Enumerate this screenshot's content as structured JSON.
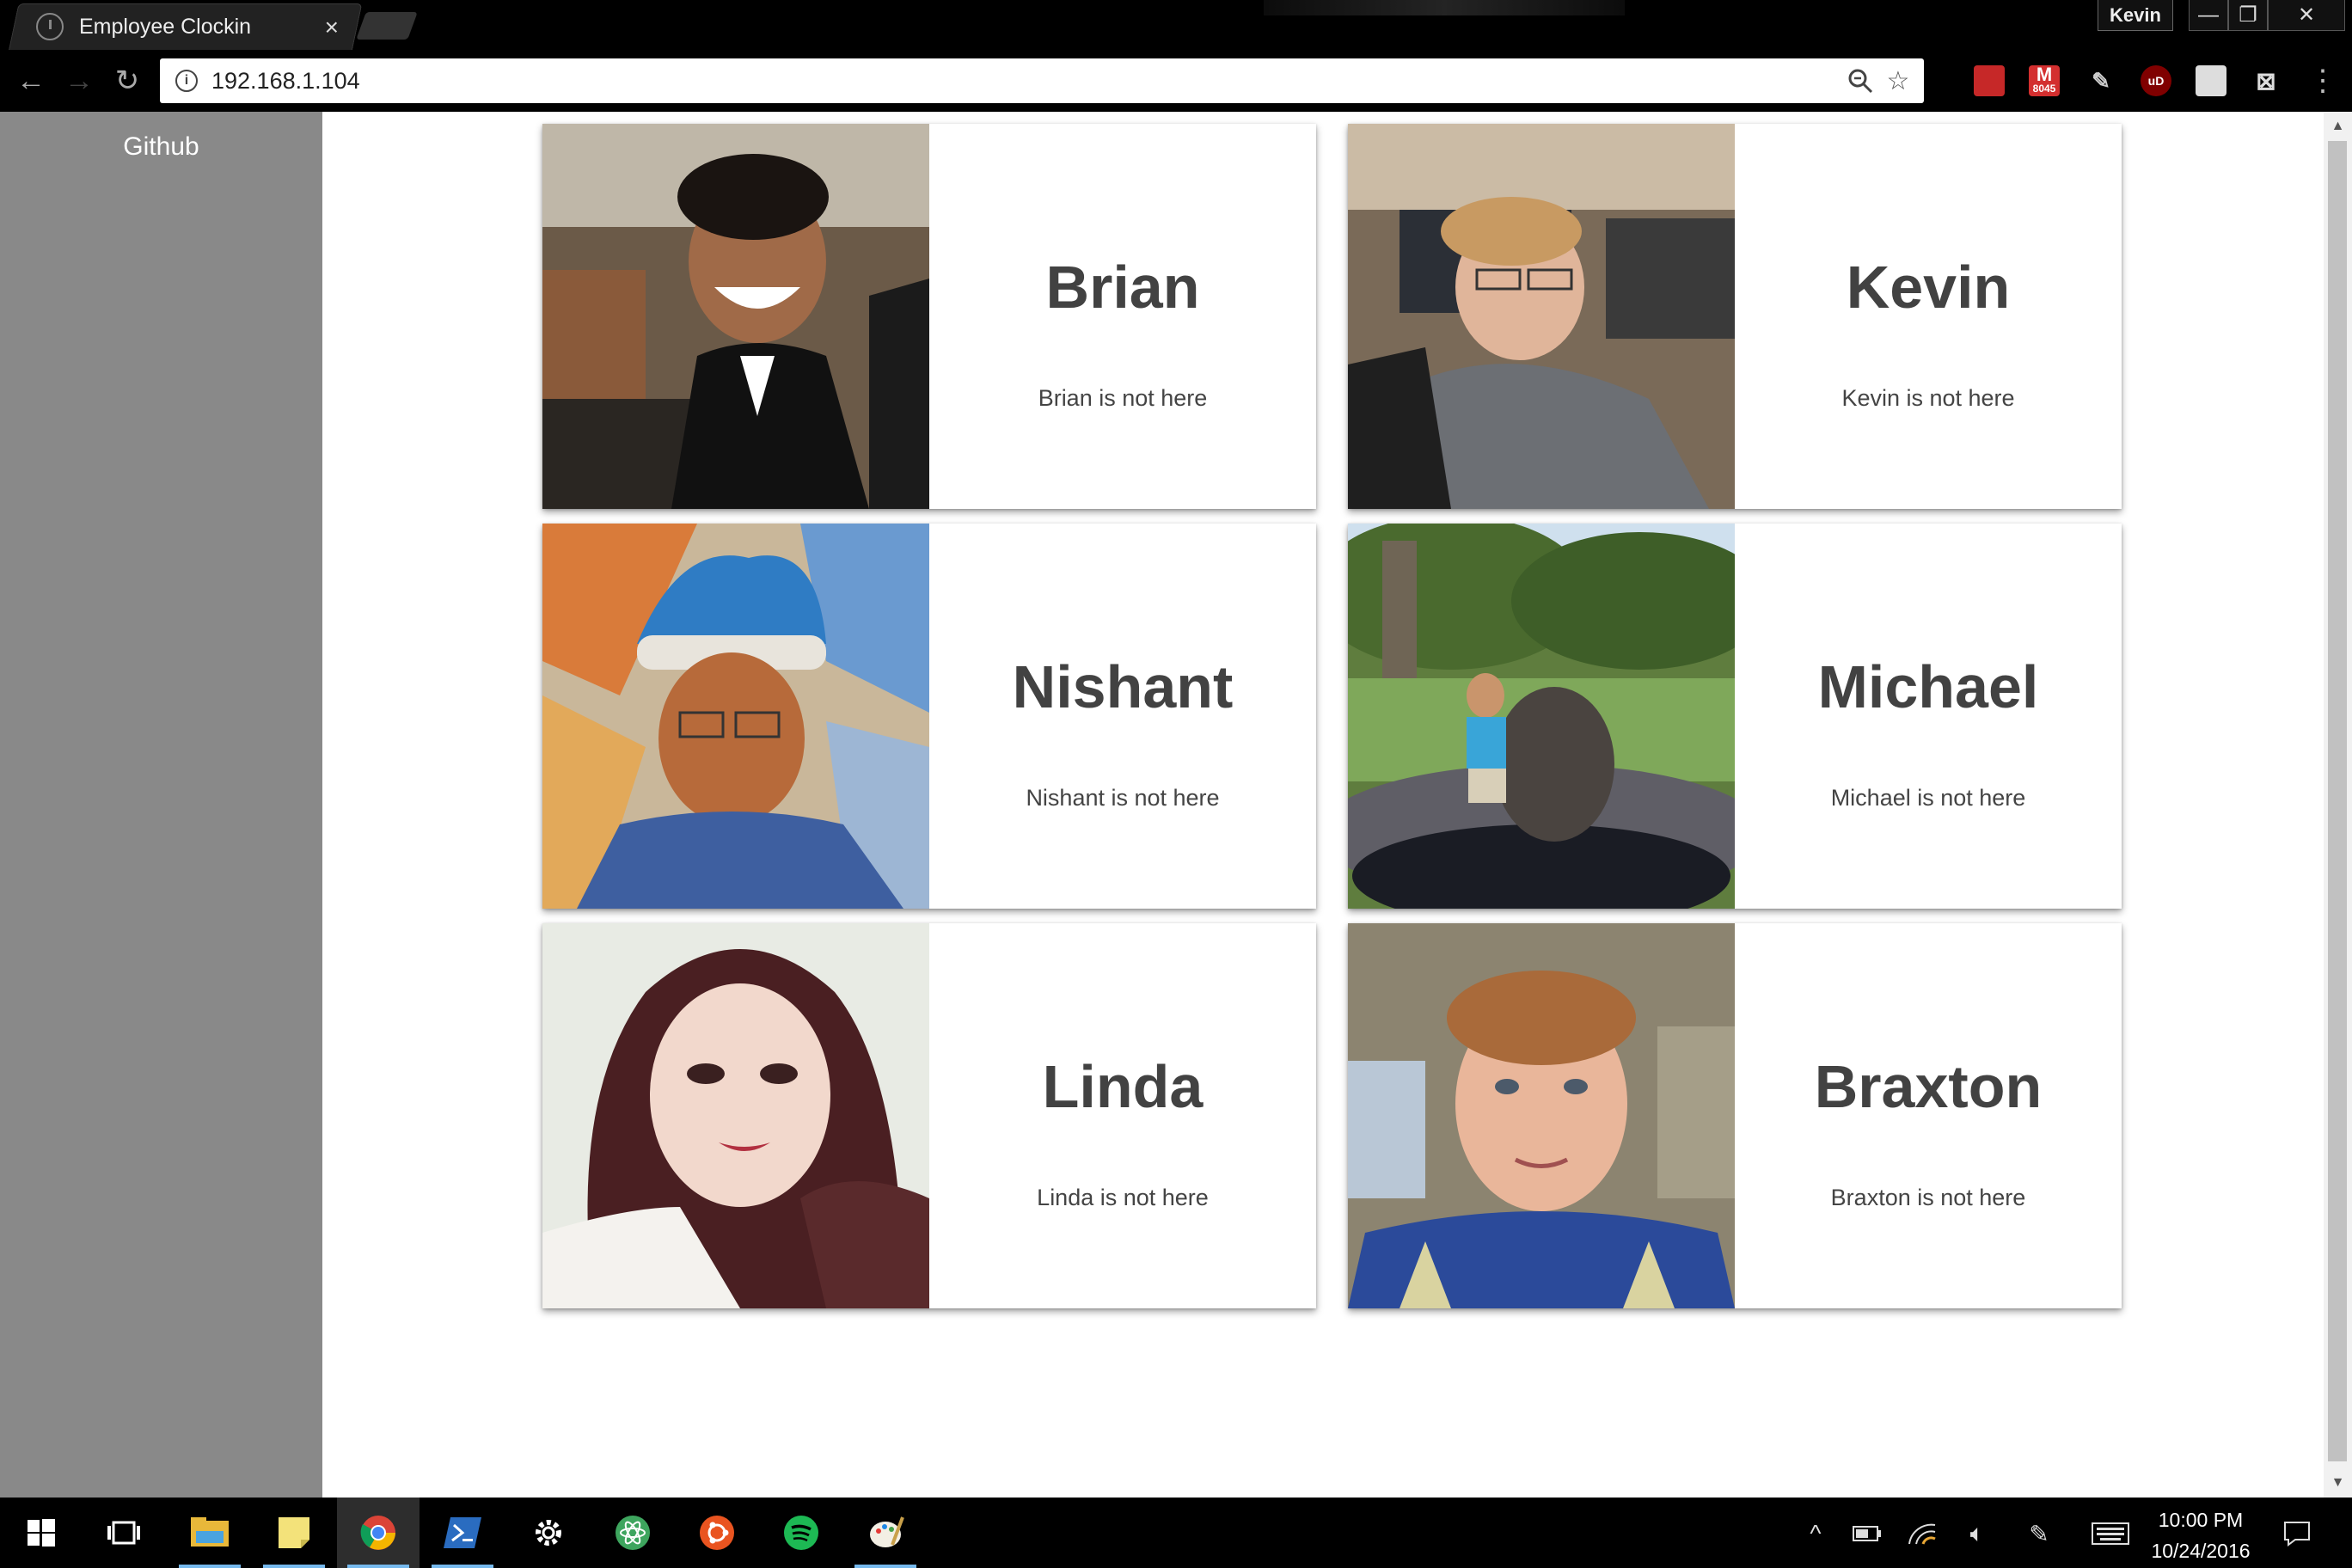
{
  "browser": {
    "tab_title": "Employee Clockin",
    "tab_close": "×",
    "profile_name": "Kevin",
    "url": "192.168.1.104",
    "extension_badge": "8045"
  },
  "window_controls": {
    "minimize": "—",
    "restore": "❐",
    "close": "✕"
  },
  "sidebar": {
    "link": "Github"
  },
  "employees": [
    {
      "name": "Brian",
      "status": "Brian is not here"
    },
    {
      "name": "Kevin",
      "status": "Kevin is not here"
    },
    {
      "name": "Nishant",
      "status": "Nishant is not here"
    },
    {
      "name": "Michael",
      "status": "Michael is not here"
    },
    {
      "name": "Linda",
      "status": "Linda is not here"
    },
    {
      "name": "Braxton",
      "status": "Braxton is not here"
    }
  ],
  "taskbar": {
    "time": "10:00 PM",
    "date": "10/24/2016",
    "apps": [
      "windows-start-icon",
      "task-view-icon",
      "file-explorer-icon",
      "sticky-notes-icon",
      "chrome-icon",
      "powershell-icon",
      "settings-icon",
      "atom-icon",
      "ubuntu-icon",
      "spotify-icon",
      "paint-icon"
    ]
  }
}
